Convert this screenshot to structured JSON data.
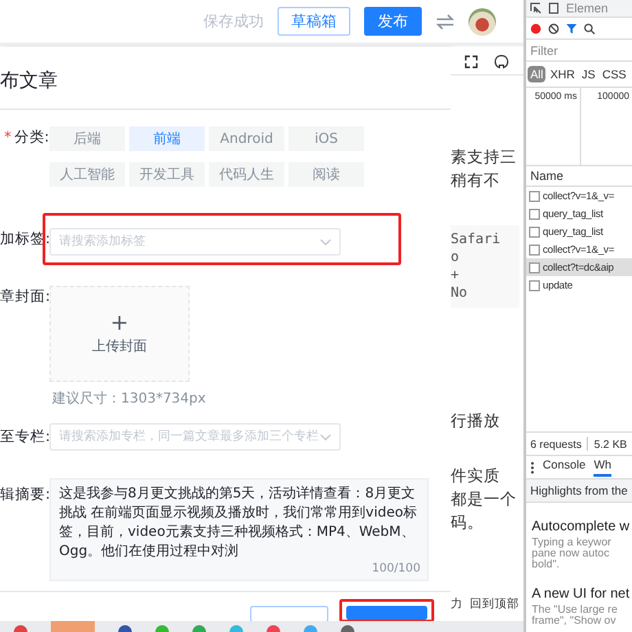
{
  "header": {
    "status": "保存成功",
    "buttons": [
      {
        "label": "草稿箱",
        "kind": "outline"
      },
      {
        "label": "发布",
        "kind": "primary"
      }
    ]
  },
  "dialog": {
    "title": "布文章",
    "category": {
      "label": "分类:",
      "required_mark": "*",
      "options": [
        {
          "label": "后端",
          "selected": false
        },
        {
          "label": "前端",
          "selected": true
        },
        {
          "label": "Android",
          "selected": false
        },
        {
          "label": "iOS",
          "selected": false
        },
        {
          "label": "人工智能",
          "selected": false
        },
        {
          "label": "开发工具",
          "selected": false
        },
        {
          "label": "代码人生",
          "selected": false
        },
        {
          "label": "阅读",
          "selected": false
        }
      ]
    },
    "tags": {
      "label": "加标签:",
      "placeholder": "请搜索添加标签",
      "highlighted": true
    },
    "cover": {
      "label": "章封面:",
      "plus": "+",
      "upload_label": "上传封面",
      "hint": "建议尺寸：1303*734px"
    },
    "column": {
      "label": "至专栏:",
      "placeholder": "请搜索添加专栏，同一篇文章最多添加三个专栏"
    },
    "summary": {
      "label": "辑摘要:",
      "value": "这是我参与8月更文挑战的第5天，活动详情查看：8月更文挑战 在前端页面显示视频及播放时，我们常常用到video标签，目前，video元素支持三种视频格式：MP4、WebM、Ogg。他们在使用过程中对浏",
      "counter": "100/100"
    },
    "footer_buttons": [
      {
        "kind": "outline",
        "highlighted": false
      },
      {
        "kind": "primary",
        "highlighted": true
      }
    ]
  },
  "article": {
    "blocks": [
      {
        "kind": "text",
        "lines": [
          "素支持三",
          "稍有不"
        ]
      },
      {
        "kind": "code",
        "lines": [
          "Safari",
          "o",
          "+",
          "No"
        ]
      },
      {
        "kind": "text",
        "lines": [
          "行播放"
        ]
      },
      {
        "kind": "text",
        "lines": [
          "件实质",
          "都是一个",
          "码。"
        ]
      }
    ],
    "footer": [
      "力",
      "回到顶部"
    ]
  },
  "devtools": {
    "panel_tab": "Elemen",
    "filter_placeholder": "Filter",
    "type_filters": [
      {
        "label": "All",
        "selected": true
      },
      {
        "label": "XHR",
        "selected": false
      },
      {
        "label": "JS",
        "selected": false
      },
      {
        "label": "CSS",
        "selected": false
      }
    ],
    "timeline": [
      "50000 ms",
      "100000"
    ],
    "name_header": "Name",
    "requests": [
      {
        "name": "collect?v=1&_v=",
        "selected": false
      },
      {
        "name": "query_tag_list",
        "selected": false
      },
      {
        "name": "query_tag_list",
        "selected": false
      },
      {
        "name": "collect?v=1&_v=",
        "selected": false
      },
      {
        "name": "collect?t=dc&aip",
        "selected": true
      },
      {
        "name": "update",
        "selected": false
      }
    ],
    "summary": [
      "6 requests",
      "5.2 KB"
    ],
    "drawer_tabs": [
      {
        "label": "Console",
        "selected": false
      },
      {
        "label": "Wh",
        "selected": true
      }
    ],
    "highlights": "Highlights from the",
    "news": [
      {
        "title": "Autocomplete w",
        "body": [
          "Typing a keywor",
          "pane now autoc",
          "bold\"."
        ]
      },
      {
        "title": "A new UI for net",
        "body": [
          "The \"Use large re",
          "frame\", \"Show ov"
        ]
      }
    ]
  }
}
